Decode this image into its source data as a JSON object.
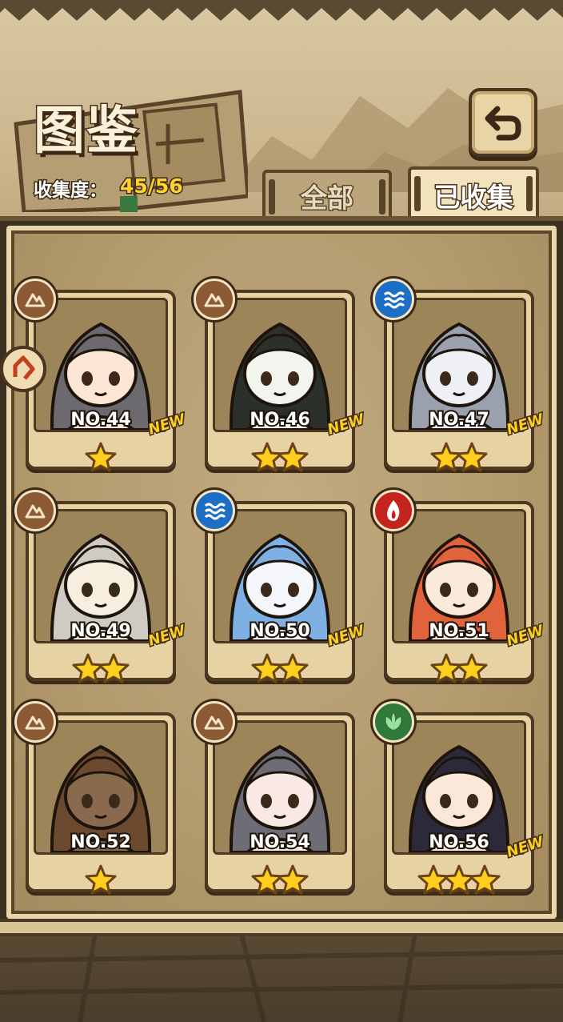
{
  "header": {
    "title": "图鉴",
    "collection_label": "收集度：",
    "collection_value": "45/56"
  },
  "tabs": [
    {
      "label": "全部",
      "selected": false
    },
    {
      "label": "已收集",
      "selected": true
    }
  ],
  "cards": [
    {
      "number": "NO.44",
      "stars": 1,
      "element": "earth",
      "is_new": true,
      "hair": "#6c6a6e",
      "face": "#fde6d6"
    },
    {
      "number": "NO.46",
      "stars": 2,
      "element": "earth",
      "is_new": true,
      "hair": "#2b302b",
      "face": "#f4f4ee"
    },
    {
      "number": "NO.47",
      "stars": 2,
      "element": "water",
      "is_new": true,
      "hair": "#9aa0ad",
      "face": "#eef0f6"
    },
    {
      "number": "NO.49",
      "stars": 2,
      "element": "earth",
      "is_new": true,
      "hair": "#cfcbc2",
      "face": "#f6efe0"
    },
    {
      "number": "NO.50",
      "stars": 2,
      "element": "water",
      "is_new": true,
      "hair": "#7fb0e4",
      "face": "#f4f6fb"
    },
    {
      "number": "NO.51",
      "stars": 2,
      "element": "fire",
      "is_new": true,
      "hair": "#e0633c",
      "face": "#fbe9dc"
    },
    {
      "number": "NO.52",
      "stars": 1,
      "element": "earth",
      "is_new": false,
      "hair": "#6b4a30",
      "face": "#8a6a4e"
    },
    {
      "number": "NO.54",
      "stars": 2,
      "element": "earth",
      "is_new": false,
      "hair": "#6e6c74",
      "face": "#fbe9e4"
    },
    {
      "number": "NO.56",
      "stars": 3,
      "element": "wood",
      "is_new": true,
      "hair": "#2c2a3a",
      "face": "#fbe8d8"
    }
  ],
  "new_badge": "NEW",
  "colors": {
    "star": "#ffcf1f",
    "gold_text": "#ffd32a",
    "frame_dark": "#4e3a23",
    "parchment": "#e6d2a2"
  },
  "icons": {
    "back": "return-arrow-icon",
    "side": "side-arrow-icon",
    "earth": "mountain-icon",
    "water": "waves-icon",
    "fire": "flame-icon",
    "wood": "leaf-icon"
  }
}
